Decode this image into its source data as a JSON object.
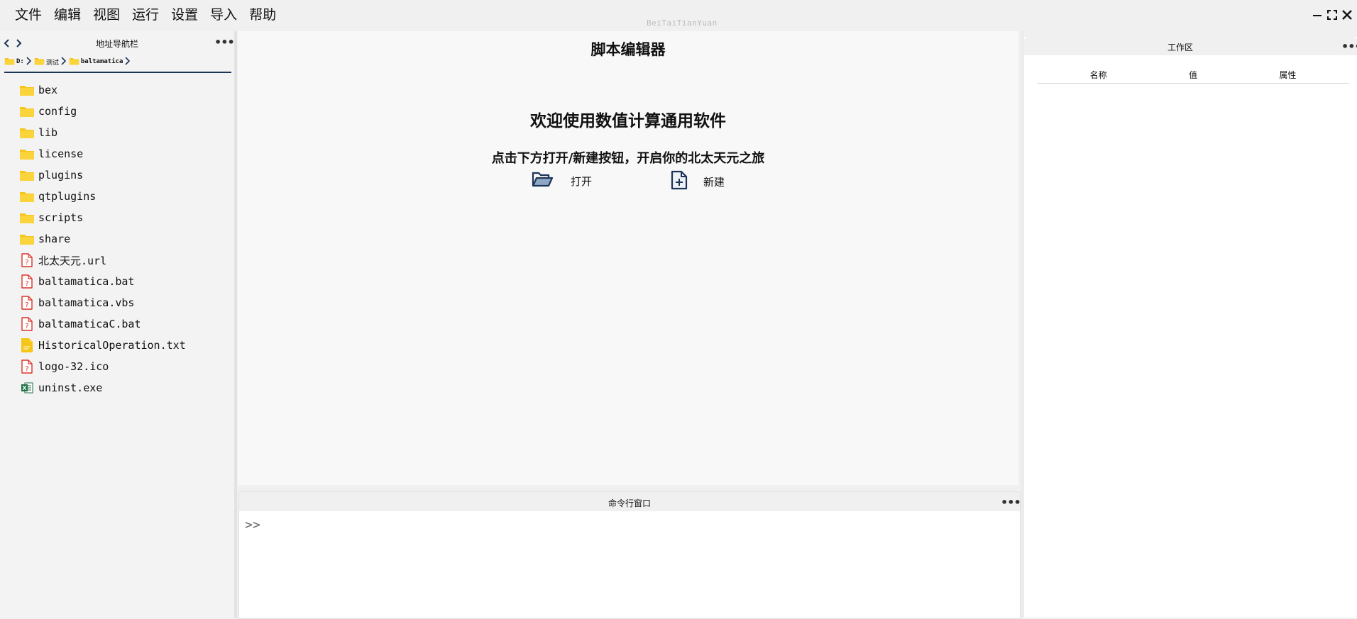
{
  "menu": [
    "文件",
    "编辑",
    "视图",
    "运行",
    "设置",
    "导入",
    "帮助"
  ],
  "brand": "BeiTaiTianYuan",
  "nav": {
    "title": "地址导航栏",
    "breadcrumb": [
      {
        "label": "D:",
        "bold": true
      },
      {
        "label": "测试",
        "bold": false
      },
      {
        "label": "baltamatica",
        "bold": true
      }
    ],
    "files": [
      {
        "name": "bex",
        "type": "folder"
      },
      {
        "name": "config",
        "type": "folder"
      },
      {
        "name": "lib",
        "type": "folder"
      },
      {
        "name": "license",
        "type": "folder"
      },
      {
        "name": "plugins",
        "type": "folder"
      },
      {
        "name": "qtplugins",
        "type": "folder"
      },
      {
        "name": "scripts",
        "type": "folder"
      },
      {
        "name": "share",
        "type": "folder"
      },
      {
        "name": "北太天元.url",
        "type": "unknown"
      },
      {
        "name": "baltamatica.bat",
        "type": "unknown"
      },
      {
        "name": "baltamatica.vbs",
        "type": "unknown"
      },
      {
        "name": "baltamaticaC.bat",
        "type": "unknown"
      },
      {
        "name": "HistoricalOperation.txt",
        "type": "text"
      },
      {
        "name": "logo-32.ico",
        "type": "unknown"
      },
      {
        "name": "uninst.exe",
        "type": "excel"
      }
    ]
  },
  "editor": {
    "title": "脚本编辑器",
    "welcome": "欢迎使用数值计算通用软件",
    "hint": "点击下方打开/新建按钮，开启你的北太天元之旅",
    "open_label": "打开",
    "new_label": "新建"
  },
  "command": {
    "title": "命令行窗口",
    "prompt": ">>"
  },
  "workspace": {
    "title": "工作区",
    "columns": [
      "名称",
      "值",
      "属性"
    ]
  },
  "colors": {
    "folder": "#f5c518",
    "accent": "#1d3557",
    "unknown_file": "#d9342b",
    "excel": "#1e7145"
  }
}
